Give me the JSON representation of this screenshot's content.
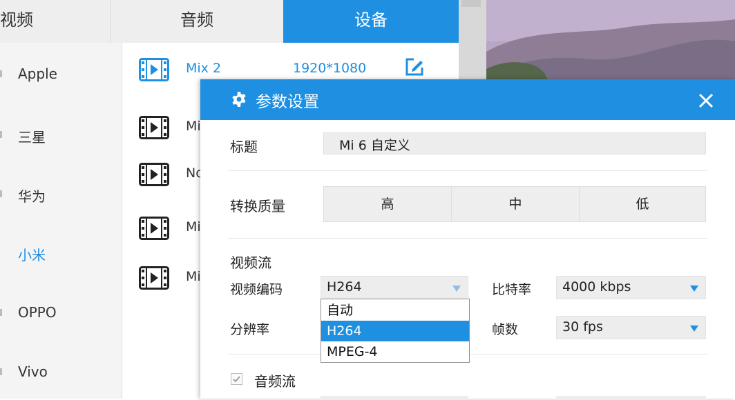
{
  "tabs": {
    "video": "视频",
    "audio": "音频",
    "device": "设备"
  },
  "brands": [
    "Apple",
    "三星",
    "华为",
    "小米",
    "OPPO",
    "Vivo"
  ],
  "selected_brand": "小米",
  "devices": [
    {
      "name": "Mix 2",
      "resolution": "1920*1080"
    },
    {
      "name": "Mi"
    },
    {
      "name": "No"
    },
    {
      "name": "Mi"
    },
    {
      "name": "Mi"
    }
  ],
  "dialog": {
    "title": "参数设置",
    "title_label": "标题",
    "title_value": "Mi 6 自定义",
    "quality_label": "转换质量",
    "quality_options": [
      "高",
      "中",
      "低"
    ],
    "video_stream_label": "视频流",
    "video_codec_label": "视频编码",
    "video_codec_value": "H264",
    "bitrate_label": "比特率",
    "bitrate_value": "4000 kbps",
    "resolution_label": "分辨率",
    "fps_label": "帧数",
    "fps_value": "30 fps",
    "codec_options": [
      "自动",
      "H264",
      "MPEG-4"
    ],
    "codec_highlighted": "H264",
    "audio_stream_label": "音频流",
    "audio_stream_checked": true
  },
  "colors": {
    "accent": "#1e8fe1"
  },
  "icons": {
    "device": "film-icon",
    "edit": "edit-icon",
    "settings": "gear-icon",
    "close": "close-icon",
    "dropdown": "triangle-down-icon",
    "checkbox": "check-icon"
  }
}
